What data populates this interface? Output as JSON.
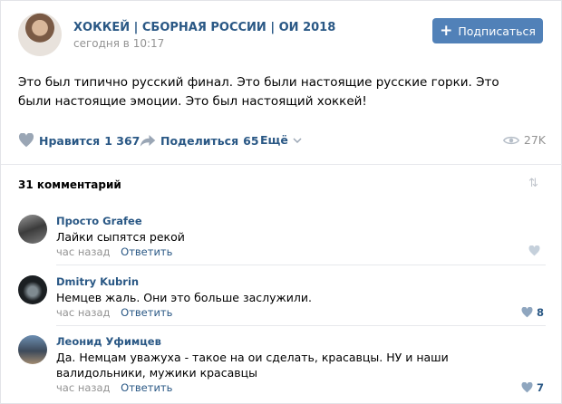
{
  "post": {
    "group_title": "ХОККЕЙ | СБОРНАЯ РОССИИ | ОИ 2018",
    "time": "сегодня в 10:17",
    "subscribe_label": "Подписаться",
    "text": "Это был типично русский финал. Это были настоящие русские горки. Это были настоящие эмоции. Это был настоящий хоккей!"
  },
  "actions": {
    "like_label": "Нравится",
    "like_count": "1 367",
    "share_label": "Поделиться",
    "share_count": "65",
    "more_label": "Ещё",
    "views": "27K"
  },
  "comments_header": "31 комментарий",
  "comments": [
    {
      "author": "Просто Grafee",
      "text": "Лайки сыпятся рекой",
      "time": "час назад",
      "reply": "Ответить",
      "likes": ""
    },
    {
      "author": "Dmitry Kubrin",
      "text": "Немцев жаль. Они это больше заслужили.",
      "time": "час назад",
      "reply": "Ответить",
      "likes": "8"
    },
    {
      "author": "Леонид Уфимцев",
      "text": "Да. Немцам уважуха - такое на ои сделать, красавцы. НУ и наши валидольники, мужики красавцы",
      "time": "час назад",
      "reply": "Ответить",
      "likes": "7"
    }
  ],
  "colors": {
    "link": "#2a5885",
    "button": "#5181b8",
    "muted": "#939393"
  }
}
